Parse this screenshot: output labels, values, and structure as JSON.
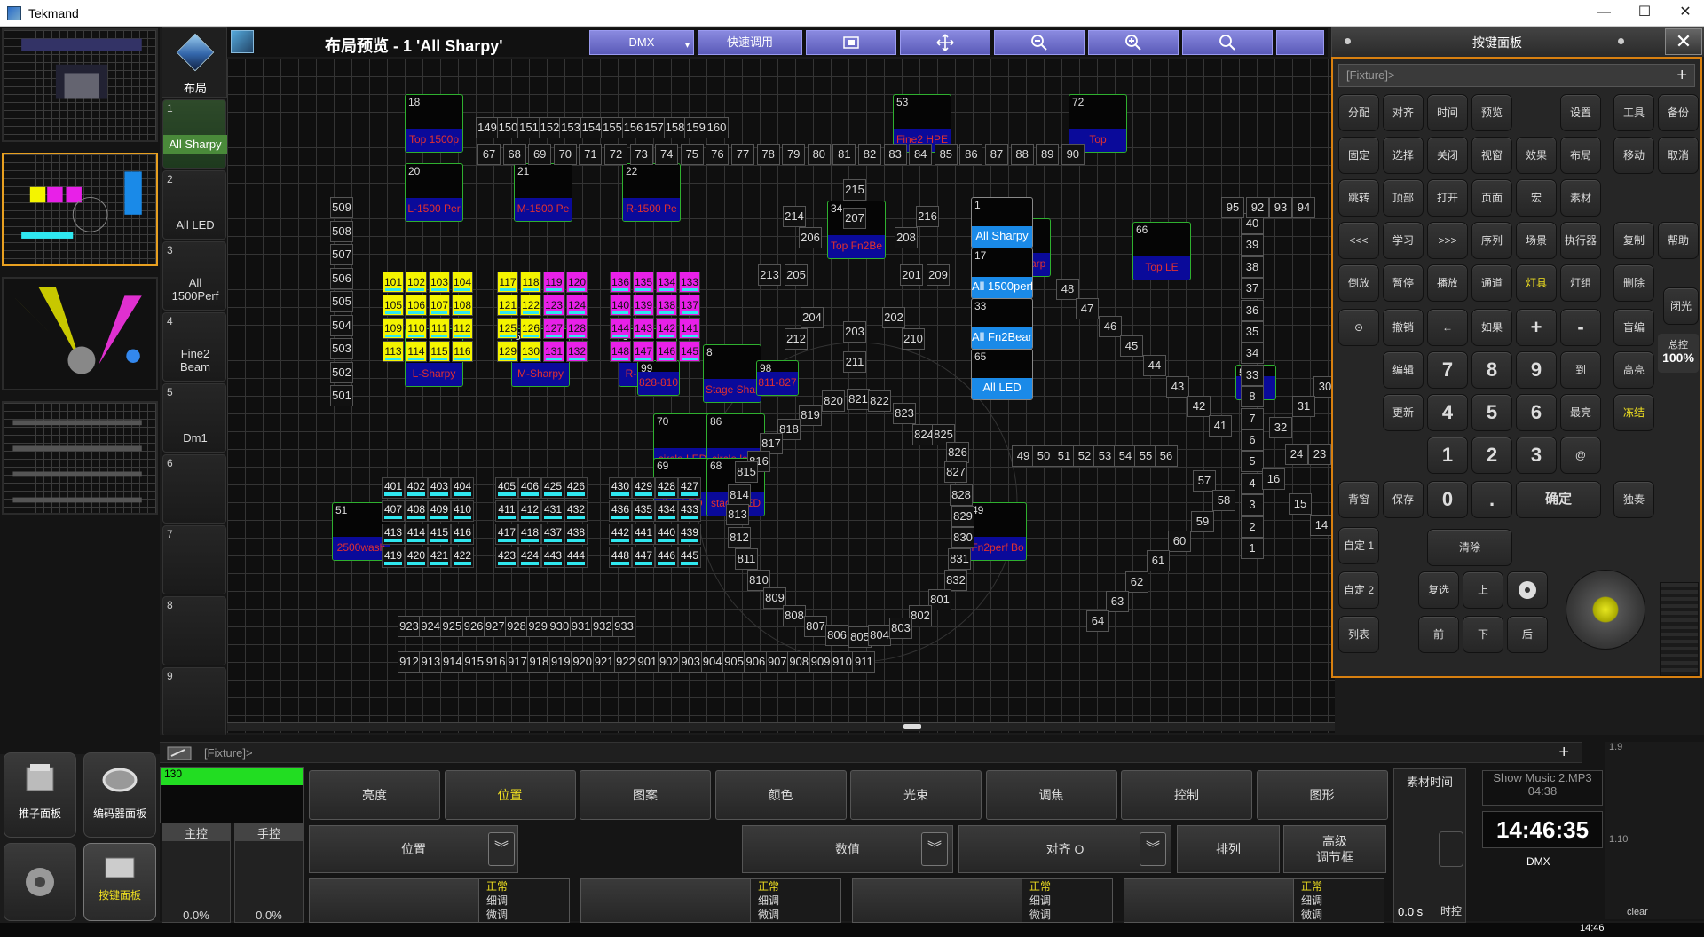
{
  "window": {
    "title": "Tekmand",
    "controls": [
      "—",
      "☐",
      "✕"
    ]
  },
  "views": {
    "header_label": "布局",
    "items": [
      {
        "n": "1",
        "label": "All Sharpy"
      },
      {
        "n": "2",
        "label": "All LED"
      },
      {
        "n": "3",
        "label": "All 1500Perf"
      },
      {
        "n": "4",
        "label": "Fine2 Beam"
      },
      {
        "n": "5",
        "label": "Dm1"
      },
      {
        "n": "6",
        "label": ""
      },
      {
        "n": "7",
        "label": ""
      },
      {
        "n": "8",
        "label": ""
      },
      {
        "n": "9",
        "label": ""
      }
    ]
  },
  "toolbar": {
    "title": "布局预览 - 1 'All Sharpy'",
    "dmx": "DMX",
    "quick": "快速调用",
    "dropdown_icon": "▾"
  },
  "stage": {
    "big_fixtures": [
      {
        "num": "18",
        "name": "Top 1500p"
      },
      {
        "num": "53",
        "name": "Fine2 HPE"
      },
      {
        "num": "72",
        "name": "Top"
      },
      {
        "num": "20",
        "name": "L-1500 Per"
      },
      {
        "num": "21",
        "name": "M-1500 Pe"
      },
      {
        "num": "22",
        "name": "R-1500 Pe"
      },
      {
        "num": "34",
        "name": "Top Fn2Be"
      },
      {
        "num": "2",
        "name": "Top Sharp"
      },
      {
        "num": "66",
        "name": "Top LE"
      },
      {
        "num": "4",
        "name": "L-Sharpy"
      },
      {
        "num": "5",
        "name": "M-Sharpy"
      },
      {
        "num": "6",
        "name": "R-Sharpy"
      },
      {
        "num": "99",
        "name": "828-810"
      },
      {
        "num": "8",
        "name": "Stage Shar"
      },
      {
        "num": "98",
        "name": "811-827"
      },
      {
        "num": "70",
        "name": "circle LED"
      },
      {
        "num": "86",
        "name": "circle led1"
      },
      {
        "num": "69",
        "name": "line LED"
      },
      {
        "num": "68",
        "name": "stage LED"
      },
      {
        "num": "51",
        "name": "2500wash"
      },
      {
        "num": "49",
        "name": "Fn2perf Bo"
      },
      {
        "num": "54",
        "name": "Lin"
      }
    ],
    "groups": [
      {
        "num": "1",
        "name": "All Sharpy"
      },
      {
        "num": "17",
        "name": "All 1500perf"
      },
      {
        "num": "33",
        "name": "All Fn2Beam"
      },
      {
        "num": "65",
        "name": "All LED"
      }
    ],
    "row_top1": [
      "149",
      "150",
      "151",
      "152",
      "153",
      "154",
      "155",
      "156",
      "157",
      "158",
      "159",
      "160"
    ],
    "row_top2": [
      "67",
      "68",
      "69",
      "70",
      "71",
      "72",
      "73",
      "74",
      "75",
      "76",
      "77",
      "78",
      "79",
      "80",
      "81",
      "82",
      "83",
      "84",
      "85",
      "86",
      "87",
      "88",
      "89",
      "90"
    ],
    "left_col": [
      "509",
      "508",
      "507",
      "506",
      "505",
      "504",
      "503",
      "502",
      "501"
    ],
    "grid_a": [
      "101",
      "102",
      "103",
      "104",
      "105",
      "106",
      "107",
      "108",
      "109",
      "110",
      "111",
      "112",
      "113",
      "114",
      "115",
      "116"
    ],
    "grid_b": [
      "117",
      "118",
      "119",
      "120",
      "121",
      "122",
      "123",
      "124",
      "125",
      "126",
      "127",
      "128",
      "129",
      "130",
      "131",
      "132"
    ],
    "grid_c": [
      "136",
      "135",
      "134",
      "133",
      "140",
      "139",
      "138",
      "137",
      "144",
      "143",
      "142",
      "141",
      "148",
      "147",
      "146",
      "145"
    ],
    "grid_d": [
      "401",
      "402",
      "403",
      "404",
      "407",
      "408",
      "409",
      "410",
      "413",
      "414",
      "415",
      "416",
      "419",
      "420",
      "421",
      "422"
    ],
    "grid_e": [
      "405",
      "406",
      "425",
      "426",
      "411",
      "412",
      "431",
      "432",
      "417",
      "418",
      "437",
      "438",
      "423",
      "424",
      "443",
      "444"
    ],
    "grid_f": [
      "430",
      "429",
      "428",
      "427",
      "436",
      "435",
      "434",
      "433",
      "442",
      "441",
      "440",
      "439",
      "448",
      "447",
      "446",
      "445"
    ],
    "row_bottom1": [
      "923",
      "924",
      "925",
      "926",
      "927",
      "928",
      "929",
      "930",
      "931",
      "932",
      "933"
    ],
    "row_bottom2": [
      "912",
      "913",
      "914",
      "915",
      "916",
      "917",
      "918",
      "919",
      "920",
      "921",
      "922",
      "901",
      "902",
      "903",
      "904",
      "905",
      "906",
      "907",
      "908",
      "909",
      "910",
      "911"
    ],
    "circle": [
      "215",
      "214",
      "216",
      "207",
      "206",
      "208",
      "213",
      "205",
      "201",
      "209",
      "204",
      "202",
      "212",
      "203",
      "210",
      "211",
      "820",
      "821",
      "822",
      "819",
      "823",
      "818",
      "824",
      "817",
      "825",
      "816",
      "826",
      "815",
      "827",
      "814",
      "828",
      "813",
      "829",
      "812",
      "830",
      "811",
      "831",
      "810",
      "832",
      "809",
      "801",
      "808",
      "802",
      "807",
      "806",
      "805",
      "804",
      "803"
    ],
    "mid_row": [
      "49",
      "50",
      "51",
      "52",
      "53",
      "54",
      "55",
      "56"
    ],
    "diag_left": [
      "48",
      "47",
      "46",
      "45",
      "44",
      "43",
      "42",
      "41"
    ],
    "diag_right": [
      "57",
      "58",
      "59",
      "60",
      "61",
      "62",
      "63",
      "64"
    ],
    "right_col": [
      "40",
      "39",
      "38",
      "37",
      "36",
      "35",
      "34",
      "33",
      "8",
      "7",
      "6",
      "5",
      "4",
      "3",
      "2",
      "1"
    ],
    "right_misc": [
      "95",
      "92",
      "93",
      "94",
      "30",
      "31",
      "32",
      "24",
      "23",
      "16",
      "15",
      "14"
    ]
  },
  "keypad": {
    "title": "按键面板",
    "cmd": "[Fixture]>",
    "plus": "+",
    "close": "✕",
    "rows": [
      [
        "分配",
        "对齐",
        "时间",
        "预览",
        "",
        "设置",
        "工具",
        "备份"
      ],
      [
        "固定",
        "选择",
        "关闭",
        "视窗",
        "效果",
        "布局",
        "移动",
        "取消"
      ],
      [
        "跳转",
        "顶部",
        "打开",
        "页面",
        "宏",
        "素材",
        "",
        ""
      ],
      [
        "<<<",
        "学习",
        ">>>",
        "序列",
        "场景",
        "执行器",
        "复制",
        "帮助"
      ],
      [
        "倒放",
        "暂停",
        "播放",
        "通道",
        "灯具",
        "灯组",
        "删除",
        ""
      ],
      [
        "⊙",
        "撤销",
        "←",
        "如果",
        "+",
        "-",
        "盲编",
        "闭光"
      ],
      [
        "",
        "编辑",
        "7",
        "8",
        "9",
        "到",
        "高亮",
        ""
      ],
      [
        "",
        "更新",
        "4",
        "5",
        "6",
        "最亮",
        "冻结",
        ""
      ],
      [
        "",
        "",
        "1",
        "2",
        "3",
        "@",
        "",
        ""
      ],
      [
        "背窗",
        "保存",
        "0",
        ".",
        "确定",
        "",
        "独奏",
        ""
      ]
    ],
    "extra": {
      "custom1": "自定 1",
      "custom2": "自定 2",
      "list": "列表",
      "clear": "清除",
      "copy": "复选",
      "up": "上",
      "down": "下",
      "prev": "前",
      "next": "后",
      "master": "总控",
      "master_val": "100%"
    }
  },
  "bottom": {
    "cmdline": "[Fixture]>",
    "plus": "+",
    "exec_val": "130",
    "master": "主控",
    "hand": "手控",
    "m_pct": "0.0%",
    "h_pct": "0.0%",
    "tabs": [
      "亮度",
      "位置",
      "图案",
      "颜色",
      "光束",
      "调焦",
      "控制",
      "图形"
    ],
    "drop1": "位置",
    "drop2": "数值",
    "drop3": "对齐 O",
    "sort": "排列",
    "adv": "高级\n调节框",
    "enc_menu": [
      "正常",
      "细调",
      "微调"
    ],
    "clip_time": "素材时间",
    "music": "Show Music 2.MP3",
    "music_time": "04:38",
    "clock": "14:46:35",
    "zero_s": "0.0 s",
    "time_lbl": "时控",
    "dmx": "DMX",
    "v19": "1.9",
    "v110": "1.10",
    "clear": "clear",
    "taskbar_time": "14:46"
  },
  "leftbottom": {
    "fader_panel": "推子面板",
    "encoder_panel": "编码器面板",
    "key_panel": "按键面板"
  }
}
